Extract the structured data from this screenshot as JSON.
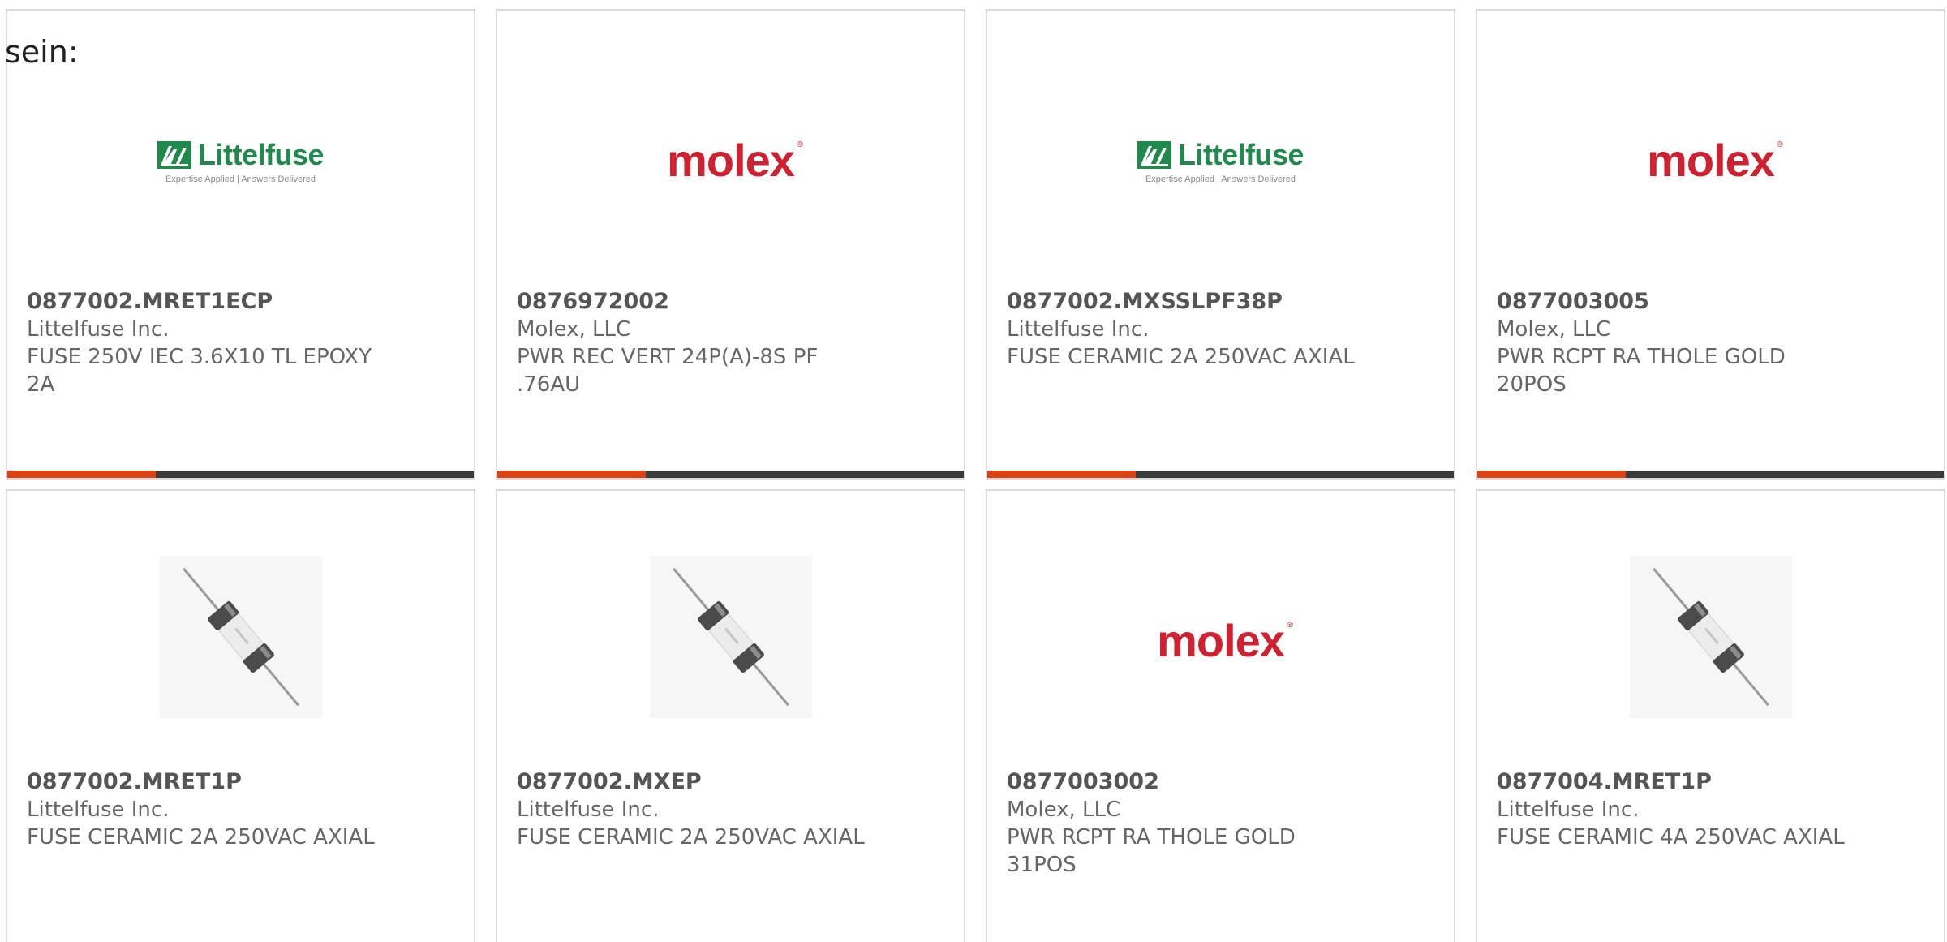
{
  "intro_text": "sein:",
  "colors": {
    "accent": "#e04112",
    "bar": "#3a3a3a",
    "littelfuse_green": "#1f8a4c",
    "molex_red": "#d1202f"
  },
  "logos": {
    "littelfuse": {
      "name": "Littelfuse",
      "tagline": "Expertise Applied | Answers Delivered"
    },
    "molex": {
      "name": "molex"
    }
  },
  "products": [
    {
      "part_number": "0877002.MRET1ECP",
      "manufacturer": "Littelfuse Inc.",
      "description": "FUSE 250V IEC 3.6X10 TL EPOXY 2A",
      "image": "littelfuse-logo"
    },
    {
      "part_number": "0876972002",
      "manufacturer": "Molex, LLC",
      "description": "PWR REC VERT 24P(A)-8S PF .76AU",
      "image": "molex-logo"
    },
    {
      "part_number": "0877002.MXSSLPF38P",
      "manufacturer": "Littelfuse Inc.",
      "description": "FUSE CERAMIC 2A 250VAC AXIAL",
      "image": "littelfuse-logo"
    },
    {
      "part_number": "0877003005",
      "manufacturer": "Molex, LLC",
      "description": "PWR RCPT RA THOLE GOLD 20POS",
      "image": "molex-logo"
    },
    {
      "part_number": "0877002.MRET1P",
      "manufacturer": "Littelfuse Inc.",
      "description": "FUSE CERAMIC 2A 250VAC AXIAL",
      "image": "fuse-photo"
    },
    {
      "part_number": "0877002.MXEP",
      "manufacturer": "Littelfuse Inc.",
      "description": "FUSE CERAMIC 2A 250VAC AXIAL",
      "image": "fuse-photo"
    },
    {
      "part_number": "0877003002",
      "manufacturer": "Molex, LLC",
      "description": "PWR RCPT RA THOLE GOLD 31POS",
      "image": "molex-logo"
    },
    {
      "part_number": "0877004.MRET1P",
      "manufacturer": "Littelfuse Inc.",
      "description": "FUSE CERAMIC 4A 250VAC AXIAL",
      "image": "fuse-photo"
    }
  ]
}
